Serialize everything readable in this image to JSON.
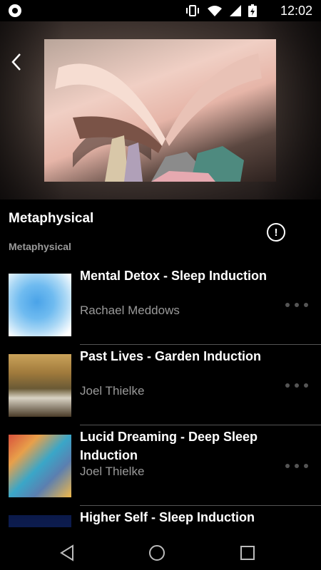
{
  "status": {
    "time": "12:02",
    "icons": [
      "vibrate-icon",
      "wifi-icon",
      "signal-icon",
      "battery-charging-icon"
    ]
  },
  "header": {
    "back_icon": "chevron-left-icon"
  },
  "album": {
    "title": "Metaphysical",
    "category": "Metaphysical",
    "info_icon": "info-icon",
    "info_glyph": "!"
  },
  "tracks": [
    {
      "title": "Mental Detox - Sleep Induction",
      "artist": "Rachael Meddows"
    },
    {
      "title": "Past Lives - Garden Induction",
      "artist": "Joel Thielke"
    },
    {
      "title": "Lucid Dreaming - Deep Sleep Induction",
      "artist": "Joel Thielke"
    },
    {
      "title": "Higher Self - Sleep Induction",
      "artist": ""
    }
  ],
  "nav": {
    "back_icon": "triangle-back-icon",
    "home_icon": "circle-home-icon",
    "recents_icon": "square-recents-icon"
  },
  "colors": {
    "background": "#000000",
    "secondary_text": "#9a9a9a",
    "divider": "#555555"
  }
}
